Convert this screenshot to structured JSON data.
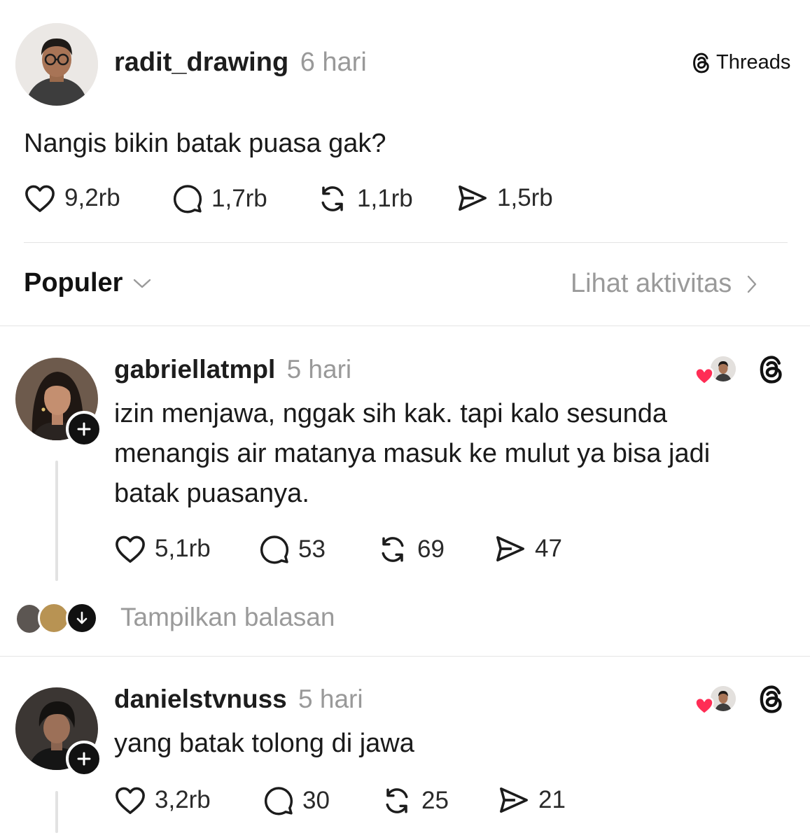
{
  "post": {
    "username": "radit_drawing",
    "time": "6 hari",
    "brand": "Threads",
    "text": "Nangis bikin batak puasa gak?",
    "likes": "9,2rb",
    "replies": "1,7rb",
    "reposts": "1,1rb",
    "shares": "1,5rb"
  },
  "sort": {
    "label": "Populer",
    "activity_link": "Lihat aktivitas"
  },
  "comments": [
    {
      "username": "gabriellatmpl",
      "time": "5 hari",
      "lines": [
        "izin menjawa, nggak sih kak. tapi kalo sesunda",
        "menangis air matanya masuk ke mulut ya bisa jadi",
        "batak puasanya."
      ],
      "likes": "5,1rb",
      "replies": "53",
      "reposts": "69",
      "shares": "47",
      "show_replies": "Tampilkan balasan"
    },
    {
      "username": "danielstvnuss",
      "time": "5 hari",
      "lines": [
        "yang batak tolong di jawa"
      ],
      "likes": "3,2rb",
      "replies": "30",
      "reposts": "25",
      "shares": "21"
    }
  ],
  "colors": {
    "heart_badge": "#ff2d55",
    "text": "#1a1a1a",
    "muted": "#999999"
  }
}
